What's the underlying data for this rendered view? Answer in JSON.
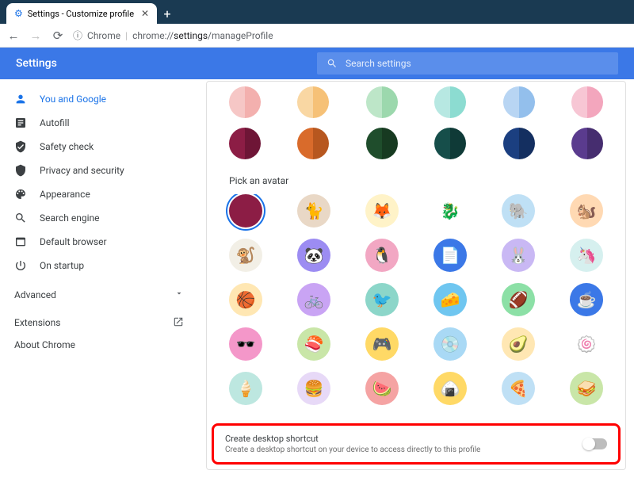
{
  "browser": {
    "tab_title": "Settings - Customize profile",
    "url_prefix": "Chrome",
    "url_host": "chrome://",
    "url_pathseg1": "settings",
    "url_pathseg2": "/manageProfile"
  },
  "header": {
    "title": "Settings",
    "search_placeholder": "Search settings"
  },
  "sidebar": {
    "items": [
      {
        "label": "You and Google"
      },
      {
        "label": "Autofill"
      },
      {
        "label": "Safety check"
      },
      {
        "label": "Privacy and security"
      },
      {
        "label": "Appearance"
      },
      {
        "label": "Search engine"
      },
      {
        "label": "Default browser"
      },
      {
        "label": "On startup"
      }
    ],
    "advanced": "Advanced",
    "extensions": "Extensions",
    "about": "About Chrome"
  },
  "main": {
    "colors_row1": [
      {
        "l": "#f6c7c6",
        "r": "#f3b0ae"
      },
      {
        "l": "#f9d7a3",
        "r": "#f6c177"
      },
      {
        "l": "#bde6c8",
        "r": "#9cd8ad"
      },
      {
        "l": "#b7e8e2",
        "r": "#8cdcd1"
      },
      {
        "l": "#b8d5f3",
        "r": "#93bfec"
      },
      {
        "l": "#f7c6d4",
        "r": "#f3a6bd"
      }
    ],
    "colors_row2": [
      {
        "l": "#8c1d45",
        "r": "#6e1536"
      },
      {
        "l": "#d96b2b",
        "r": "#b7571f"
      },
      {
        "l": "#1f4d2c",
        "r": "#173a21"
      },
      {
        "l": "#164e4a",
        "r": "#0f3a37"
      },
      {
        "l": "#1b3f80",
        "r": "#142f60"
      },
      {
        "l": "#5a3b8e",
        "r": "#462d6f"
      }
    ],
    "avatar_label": "Pick an avatar",
    "avatars": [
      [
        {
          "bg": "#8c1d45",
          "emoji": "",
          "selected": true
        },
        {
          "bg": "#e9d8c6",
          "emoji": "🐈"
        },
        {
          "bg": "#fff3c8",
          "emoji": "🦊"
        },
        {
          "bg": "#ffffff",
          "emoji": "🐉"
        },
        {
          "bg": "#bfe0f5",
          "emoji": "🐘"
        },
        {
          "bg": "#ffd9b3",
          "emoji": "🐿️"
        }
      ],
      [
        {
          "bg": "#f2efe6",
          "emoji": "🐒"
        },
        {
          "bg": "#9c8cf2",
          "emoji": "🐼"
        },
        {
          "bg": "#f2a7c3",
          "emoji": "🐧"
        },
        {
          "bg": "#3b78e7",
          "emoji": "📄"
        },
        {
          "bg": "#c9b8f4",
          "emoji": "🐰"
        },
        {
          "bg": "#d6f0ef",
          "emoji": "🦄"
        }
      ],
      [
        {
          "bg": "#ffe7b3",
          "emoji": "🏀"
        },
        {
          "bg": "#c9a4f4",
          "emoji": "🚲"
        },
        {
          "bg": "#8cd6c9",
          "emoji": "🐦"
        },
        {
          "bg": "#6fc6f0",
          "emoji": "🧀"
        },
        {
          "bg": "#8ce0a6",
          "emoji": "🏈"
        },
        {
          "bg": "#3b78e7",
          "emoji": "☕"
        }
      ],
      [
        {
          "bg": "#f497c9",
          "emoji": "🕶️"
        },
        {
          "bg": "#c9e6a8",
          "emoji": "🍣"
        },
        {
          "bg": "#ffd966",
          "emoji": "🎮"
        },
        {
          "bg": "#a9d9f5",
          "emoji": "💿"
        },
        {
          "bg": "#ffe7b3",
          "emoji": "🥑"
        },
        {
          "bg": "#ffffff",
          "emoji": "🍥"
        }
      ],
      [
        {
          "bg": "#bde7e0",
          "emoji": "🍦"
        },
        {
          "bg": "#e7d9f7",
          "emoji": "🍔"
        },
        {
          "bg": "#f5a3a3",
          "emoji": "🍉"
        },
        {
          "bg": "#ffd966",
          "emoji": "🍙"
        },
        {
          "bg": "#bfe0f5",
          "emoji": "🍕"
        },
        {
          "bg": "#c9e6a8",
          "emoji": "🥪"
        }
      ]
    ],
    "shortcut_title": "Create desktop shortcut",
    "shortcut_desc": "Create a desktop shortcut on your device to access directly to this profile"
  }
}
